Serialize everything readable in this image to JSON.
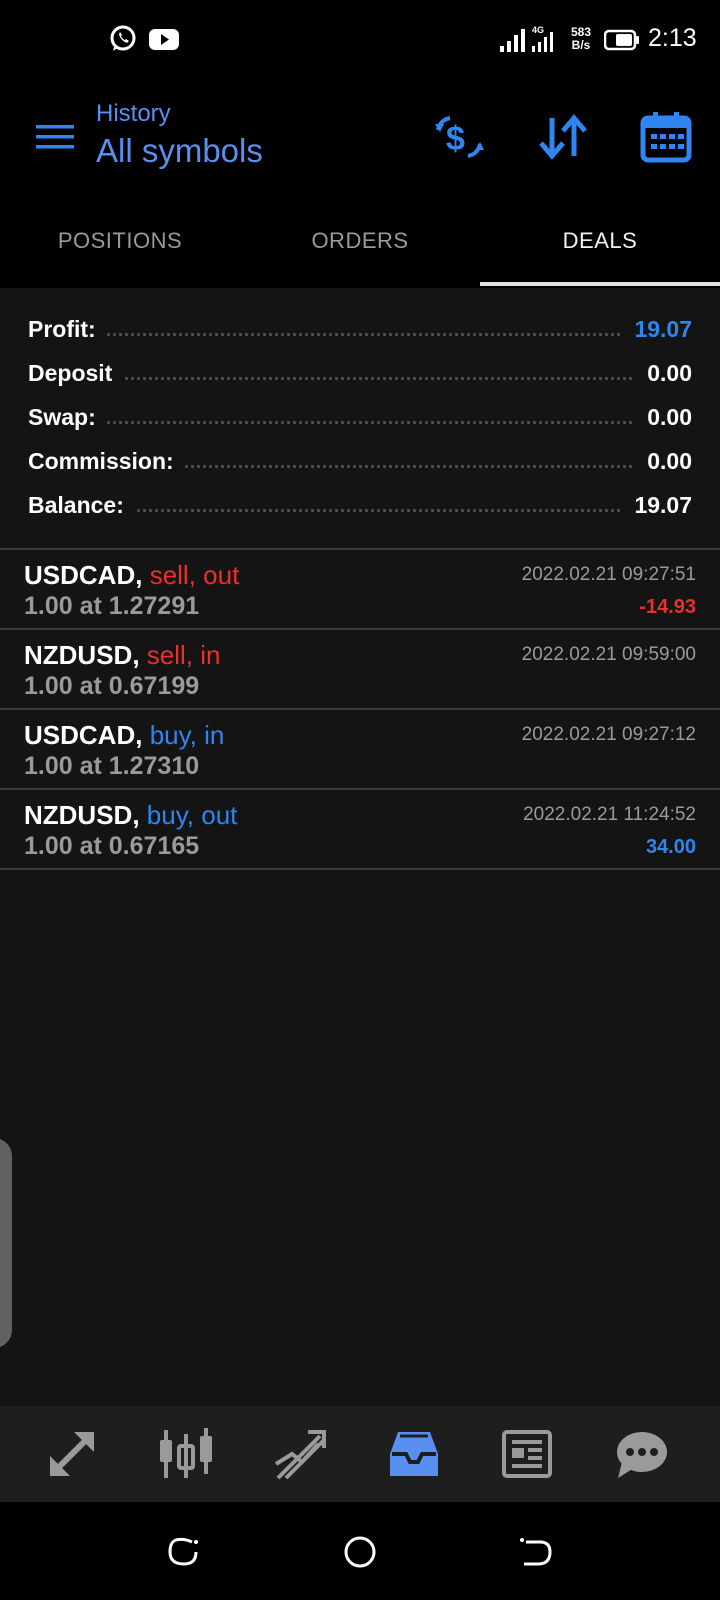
{
  "status_bar": {
    "time": "2:13",
    "network_type": "4G",
    "speed_value": "583",
    "speed_unit": "B/s",
    "icons": [
      "whatsapp-icon",
      "youtube-icon",
      "signal-icon",
      "battery-icon"
    ]
  },
  "header": {
    "subtitle": "History",
    "title": "All symbols",
    "icons": [
      "menu-icon",
      "currency-exchange-icon",
      "sort-icon",
      "calendar-icon"
    ]
  },
  "tabs": [
    {
      "label": "POSITIONS",
      "active": false
    },
    {
      "label": "ORDERS",
      "active": false
    },
    {
      "label": "DEALS",
      "active": true
    }
  ],
  "summary": [
    {
      "label": "Profit:",
      "value": "19.07"
    },
    {
      "label": "Deposit",
      "value": "0.00"
    },
    {
      "label": "Swap:",
      "value": "0.00"
    },
    {
      "label": "Commission:",
      "value": "0.00"
    },
    {
      "label": "Balance:",
      "value": "19.07"
    }
  ],
  "deals": [
    {
      "symbol": "USDCAD,",
      "side": "sell, out",
      "detail": "1.00 at 1.27291",
      "time": "2022.02.21 09:27:51",
      "profit": "-14.93"
    },
    {
      "symbol": "NZDUSD,",
      "side": "sell, in",
      "detail": "1.00 at 0.67199",
      "time": "2022.02.21 09:59:00",
      "profit": ""
    },
    {
      "symbol": "USDCAD,",
      "side": "buy, in",
      "detail": "1.00 at 1.27310",
      "time": "2022.02.21 09:27:12",
      "profit": ""
    },
    {
      "symbol": "NZDUSD,",
      "side": "buy, out",
      "detail": "1.00 at 0.67165",
      "time": "2022.02.21 11:24:52",
      "profit": "34.00"
    }
  ],
  "bottom_nav": [
    {
      "icon": "quotes-icon",
      "active": false
    },
    {
      "icon": "chart-icon",
      "active": false
    },
    {
      "icon": "trade-icon",
      "active": false
    },
    {
      "icon": "history-icon",
      "active": true
    },
    {
      "icon": "news-icon",
      "active": false
    },
    {
      "icon": "messages-icon",
      "active": false
    }
  ],
  "colors": {
    "accent": "#5a8ff2",
    "blue_value": "#2f86f0",
    "red_value": "#e8302c",
    "background": "#141414"
  }
}
